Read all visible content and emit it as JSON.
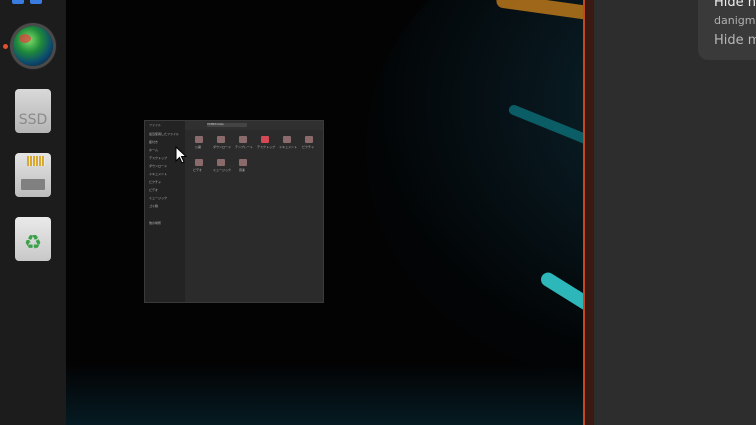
{
  "dock": {
    "items": [
      {
        "name": "browser",
        "running": true
      },
      {
        "name": "ssd-drive",
        "label": "SSD"
      },
      {
        "name": "sd-card"
      },
      {
        "name": "trash"
      }
    ]
  },
  "notification": {
    "title": "Hide h",
    "subtitle": "danigm",
    "action": "Hide m"
  },
  "file_manager": {
    "sidebar_title": "ファイル",
    "sidebar_items": [
      "最近使用したファイル",
      "星付き",
      "ホーム",
      "デスクトップ",
      "ダウンロード",
      "ドキュメント",
      "ピクチャ",
      "ビデオ",
      "ミュージック",
      "ゴミ箱",
      "他の場所"
    ],
    "path": "HOME/hidden",
    "folders": [
      "公開",
      "ダウンロード",
      "テンプレート",
      "デスクトップ",
      "ドキュメント",
      "ピクチャ",
      "ビデオ",
      "ミュージック",
      "音楽"
    ]
  },
  "colors": {
    "accent": "#c24a20",
    "dock_bg": "#1c1c1c",
    "panel_bg": "#2d2d2d"
  }
}
